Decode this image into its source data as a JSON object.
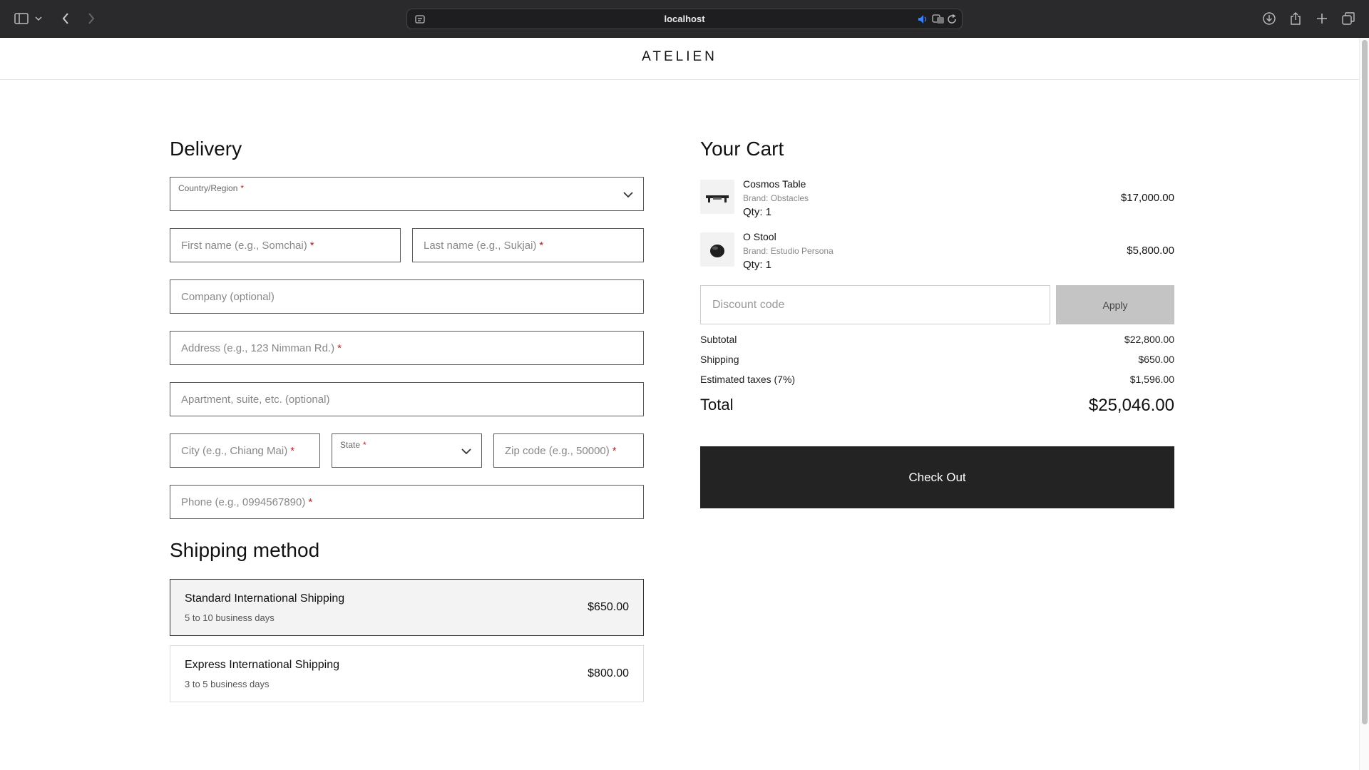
{
  "browser": {
    "url": "localhost"
  },
  "site": {
    "logo": "ATELIEN"
  },
  "delivery": {
    "title": "Delivery",
    "country_label": "Country/Region",
    "first_name_placeholder": "First name (e.g., Somchai)",
    "last_name_placeholder": "Last name (e.g., Sukjai)",
    "company_placeholder": "Company (optional)",
    "address_placeholder": "Address (e.g., 123 Nimman Rd.)",
    "apartment_placeholder": "Apartment, suite, etc. (optional)",
    "city_placeholder": "City (e.g., Chiang Mai)",
    "state_label": "State",
    "zip_placeholder": "Zip code (e.g., 50000)",
    "phone_placeholder": "Phone (e.g., 0994567890)",
    "required_mark": "*"
  },
  "shipping": {
    "title": "Shipping method",
    "options": [
      {
        "name": "Standard International Shipping",
        "eta": "5 to 10 business days",
        "price": "$650.00",
        "selected": true
      },
      {
        "name": "Express International Shipping",
        "eta": "3 to 5 business days",
        "price": "$800.00",
        "selected": false
      }
    ]
  },
  "cart": {
    "title": "Your Cart",
    "items": [
      {
        "name": "Cosmos Table",
        "brand": "Brand: Obstacles",
        "qty": "Qty: 1",
        "price": "$17,000.00",
        "icon": "table-thumbnail-icon"
      },
      {
        "name": "O Stool",
        "brand": "Brand: Estudio Persona",
        "qty": "Qty: 1",
        "price": "$5,800.00",
        "icon": "stool-thumbnail-icon"
      }
    ],
    "discount_placeholder": "Discount code",
    "apply_label": "Apply",
    "subtotal_label": "Subtotal",
    "subtotal_value": "$22,800.00",
    "shipping_label": "Shipping",
    "shipping_value": "$650.00",
    "taxes_label": "Estimated taxes (7%)",
    "taxes_value": "$1,596.00",
    "total_label": "Total",
    "total_value": "$25,046.00",
    "checkout_label": "Check Out"
  },
  "colors": {
    "required": "#dd1111",
    "checkout_bg": "#232323",
    "apply_bg": "#c4c4c4"
  }
}
